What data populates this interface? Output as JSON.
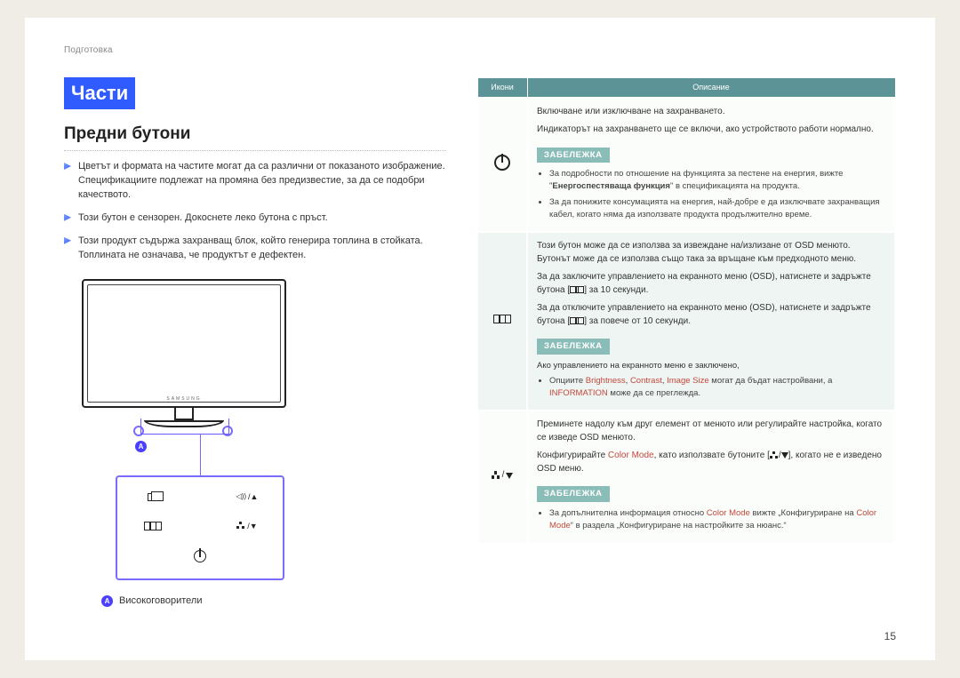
{
  "header": "Подготовка",
  "title_parts": "Части",
  "subtitle": "Предни бутони",
  "bullets": [
    "Цветът и формата на частите могат да са различни от показаното изображение. Спецификациите подлежат на промяна без предизвестие, за да се подобри качеството.",
    "Този бутон е сензорен. Докоснете леко бутона с пръст.",
    "Този продукт съдържа захранващ блок, който генерира топлина в стойката. Топлината не означава, че продуктът е дефектен."
  ],
  "brand": "SAMSUNG",
  "badgeA": "A",
  "legend_label": "Високоговорители",
  "panel_labels": {
    "vol": "/▲",
    "mode": "/▼"
  },
  "table": {
    "head_icons": "Икони",
    "head_desc": "Описание",
    "rows": [
      {
        "icon": "power",
        "paras": [
          "Включване или изключване на захранването.",
          "Индикаторът на захранването ще се включи, ако устройството работи нормално."
        ],
        "note_label": "ЗАБЕЛЕЖКА",
        "note_items": [
          {
            "pre": "За подробности по отношение на функцията за пестене на енергия, вижте \"",
            "bold": "Енергоспестяваща функция",
            "post": "\" в спецификацията на продукта."
          },
          {
            "plain": "За да понижите консумацията на енергия, най-добре е да изключвате захранващия кабел, когато няма да използвате продукта продължително време."
          }
        ]
      },
      {
        "icon": "menu",
        "paras": [
          "Този бутон може да се използва за извеждане на/излизане от OSD менюто. Бутонът може да се използва също така за връщане към предходното меню."
        ],
        "extra_lock_pre": "За да заключите управлението на екранното меню (OSD), натиснете и задръжте бутона [",
        "extra_lock_post": "] за 10 секунди.",
        "extra_unlock_pre": "За да отключите управлението на екранното меню (OSD), натиснете и задръжте бутона [",
        "extra_unlock_post": "] за повече от 10 секунди.",
        "note_label": "ЗАБЕЛЕЖКА",
        "note_intro": "Ако управлението на екранното меню е заключено,",
        "note_items": [
          {
            "pre": "Опциите ",
            "red1": "Brightness",
            "mid1": ", ",
            "red2": "Contrast",
            "mid2": ", ",
            "red3": "Image Size",
            "mid3": " могат да бъдат настройвани, а ",
            "red4": "INFORMATION",
            "post": " може да се преглежда."
          }
        ]
      },
      {
        "icon": "mode",
        "paras": [
          "Преминете надолу към друг елемент от менюто или регулирайте настройка, когато се изведе OSD менюто."
        ],
        "inline_pre": "Конфигурирайте ",
        "inline_red": "Color Mode",
        "inline_mid": ", като използвате бутоните [",
        "inline_post": "], когато не е изведено OSD меню.",
        "note_label": "ЗАБЕЛЕЖКА",
        "note_items": [
          {
            "pre": "За допълнителна информация относно ",
            "red1": "Color Mode",
            "mid1": " вижте „Конфигуриране на ",
            "red2": "Color Mode",
            "post": "“ в раздела „Конфигуриране на настройките за нюанс.“"
          }
        ]
      }
    ]
  },
  "page_number": "15"
}
